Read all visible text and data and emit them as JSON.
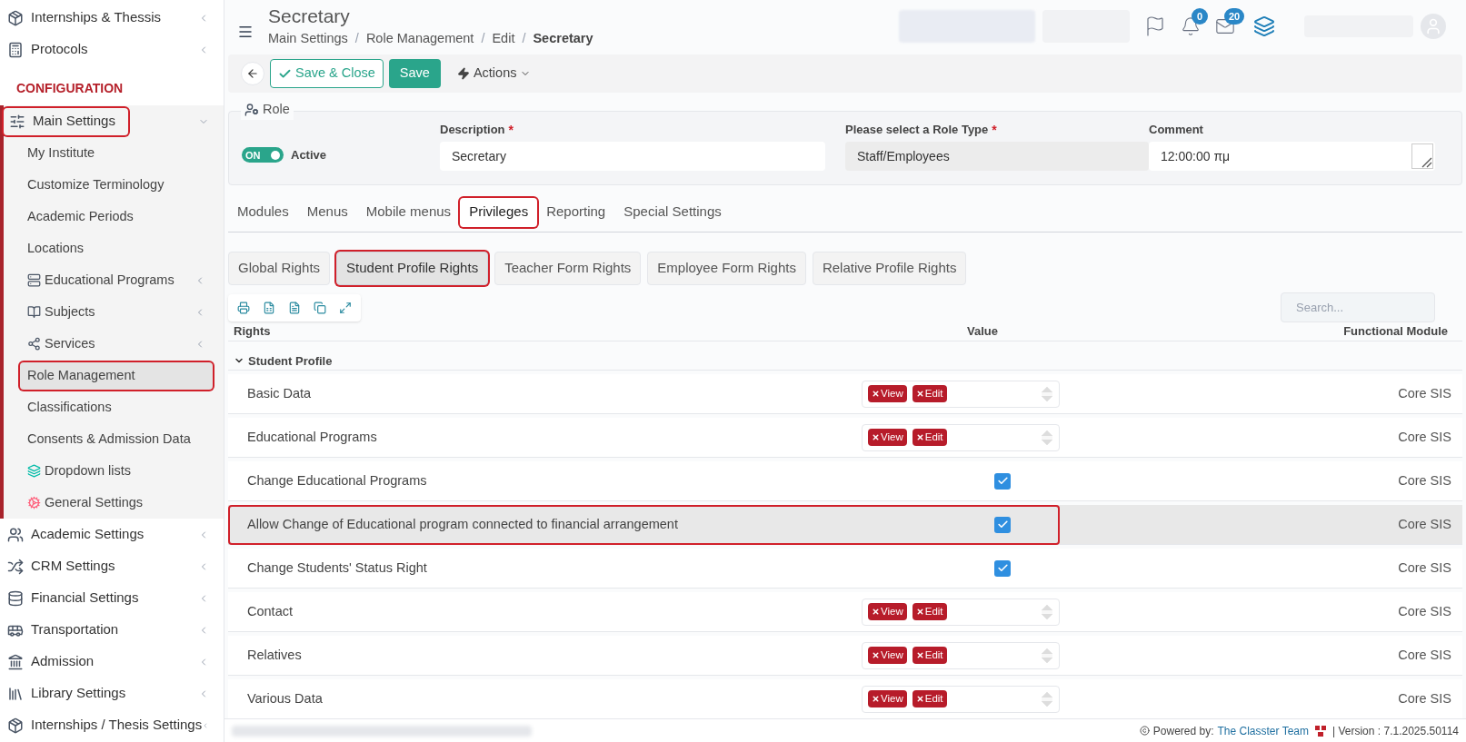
{
  "sidebar": {
    "items": [
      {
        "label": "Internships & Thessis",
        "kind": "item",
        "has_submenu": true,
        "highlighted": false
      },
      {
        "label": "Protocols",
        "kind": "item",
        "has_submenu": true,
        "highlighted": false
      },
      {
        "label": "CONFIGURATION",
        "kind": "section"
      },
      {
        "label": "Main Settings",
        "kind": "item",
        "has_submenu": true,
        "expanded": true,
        "highlighted": true,
        "children": [
          {
            "label": "My Institute",
            "has_submenu": false,
            "selected": false,
            "highlighted": false
          },
          {
            "label": "Customize Terminology",
            "has_submenu": false,
            "selected": false,
            "highlighted": false
          },
          {
            "label": "Academic Periods",
            "has_submenu": false,
            "selected": false,
            "highlighted": false
          },
          {
            "label": "Locations",
            "has_submenu": false,
            "selected": false,
            "highlighted": false
          },
          {
            "label": "Educational Programs",
            "has_submenu": true,
            "selected": false,
            "highlighted": false
          },
          {
            "label": "Subjects",
            "has_submenu": true,
            "selected": false,
            "highlighted": false
          },
          {
            "label": "Services",
            "has_submenu": true,
            "selected": false,
            "highlighted": false
          },
          {
            "label": "Role Management",
            "has_submenu": false,
            "selected": true,
            "highlighted": true
          },
          {
            "label": "Classifications",
            "has_submenu": false,
            "selected": false,
            "highlighted": false
          },
          {
            "label": "Consents & Admission Data",
            "has_submenu": false,
            "selected": false,
            "highlighted": false
          },
          {
            "label": "Dropdown lists",
            "has_submenu": false,
            "selected": false,
            "highlighted": false
          },
          {
            "label": "General Settings",
            "has_submenu": false,
            "selected": false,
            "highlighted": false
          }
        ]
      },
      {
        "label": "Academic Settings",
        "kind": "item",
        "has_submenu": true,
        "highlighted": false
      },
      {
        "label": "CRM Settings",
        "kind": "item",
        "has_submenu": true,
        "highlighted": false
      },
      {
        "label": "Financial Settings",
        "kind": "item",
        "has_submenu": true,
        "highlighted": false
      },
      {
        "label": "Transportation",
        "kind": "item",
        "has_submenu": true,
        "highlighted": false
      },
      {
        "label": "Admission",
        "kind": "item",
        "has_submenu": true,
        "highlighted": false
      },
      {
        "label": "Library Settings",
        "kind": "item",
        "has_submenu": true,
        "highlighted": false
      },
      {
        "label": "Internships / Thesis Settings",
        "kind": "item",
        "has_submenu": true,
        "highlighted": false
      }
    ]
  },
  "header": {
    "title": "Secretary",
    "breadcrumb": [
      "Main Settings",
      "/",
      "Role Management",
      "/",
      "Edit",
      "/",
      "Secretary"
    ],
    "notifications": "0",
    "messages": "20"
  },
  "toolbar": {
    "save_close": "Save & Close",
    "save": "Save",
    "actions": "Actions"
  },
  "role": {
    "legend": "Role",
    "toggle": {
      "label": "ON",
      "on": true
    },
    "status": "Active",
    "description": {
      "label": "Description",
      "required_mark": "*",
      "value": "Secretary"
    },
    "role_type": {
      "label": "Please select a Role Type",
      "required_mark": "*",
      "value": "Staff/Employees"
    },
    "comment": {
      "label": "Comment",
      "value": "12:00:00 πμ"
    }
  },
  "tabs": [
    {
      "label": "Modules",
      "selected": false,
      "highlighted": false
    },
    {
      "label": "Menus",
      "selected": false,
      "highlighted": false
    },
    {
      "label": "Mobile menus",
      "selected": false,
      "highlighted": false
    },
    {
      "label": "Privileges",
      "selected": true,
      "highlighted": true
    },
    {
      "label": "Reporting",
      "selected": false,
      "highlighted": false
    },
    {
      "label": "Special Settings",
      "selected": false,
      "highlighted": false
    }
  ],
  "subtabs": [
    {
      "label": "Global Rights",
      "selected": false,
      "highlighted": false
    },
    {
      "label": "Student Profile Rights",
      "selected": true,
      "highlighted": true
    },
    {
      "label": "Teacher Form Rights",
      "selected": false,
      "highlighted": false
    },
    {
      "label": "Employee Form Rights",
      "selected": false,
      "highlighted": false
    },
    {
      "label": "Relative Profile Rights",
      "selected": false,
      "highlighted": false
    }
  ],
  "search": {
    "placeholder": "Search..."
  },
  "table": {
    "columns": [
      "Rights",
      "Value",
      "Functional Module"
    ],
    "group": {
      "label": "Student Profile",
      "expanded": true
    },
    "rows": [
      {
        "label": "Basic Data",
        "kind": "tags",
        "tags": [
          "View",
          "Edit"
        ],
        "module": "Core SIS",
        "selected": false,
        "highlighted": false
      },
      {
        "label": "Educational Programs",
        "kind": "tags",
        "tags": [
          "View",
          "Edit"
        ],
        "module": "Core SIS",
        "selected": false,
        "highlighted": false
      },
      {
        "label": "Change Educational Programs",
        "kind": "checkbox",
        "checked": true,
        "module": "Core SIS",
        "selected": false,
        "highlighted": false
      },
      {
        "label": "Allow Change of Educational program connected to financial arrangement",
        "kind": "checkbox",
        "checked": true,
        "module": "Core SIS",
        "selected": true,
        "highlighted": true
      },
      {
        "label": "Change Students' Status Right",
        "kind": "checkbox",
        "checked": true,
        "module": "Core SIS",
        "selected": false,
        "highlighted": false
      },
      {
        "label": "Contact",
        "kind": "tags",
        "tags": [
          "View",
          "Edit"
        ],
        "module": "Core SIS",
        "selected": false,
        "highlighted": false
      },
      {
        "label": "Relatives",
        "kind": "tags",
        "tags": [
          "View",
          "Edit"
        ],
        "module": "Core SIS",
        "selected": false,
        "highlighted": false
      },
      {
        "label": "Various Data",
        "kind": "tags",
        "tags": [
          "View",
          "Edit"
        ],
        "module": "Core SIS",
        "selected": false,
        "highlighted": false
      }
    ]
  },
  "footer": {
    "powered": "Powered by:",
    "team": "The Classter Team",
    "version": "| Version : 7.1.2025.50114"
  }
}
